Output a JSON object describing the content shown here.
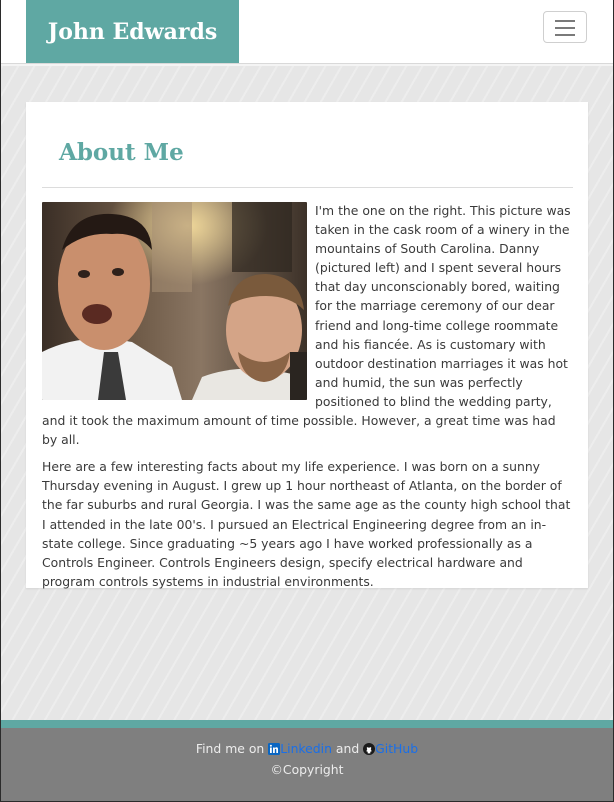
{
  "navbar": {
    "brand": "John Edwards"
  },
  "about": {
    "title": "About Me",
    "photo_alt": "Two men taking a selfie in a winery cask room",
    "paragraph1": "I'm the one on the right. This picture was taken in the cask room of a winery in the mountains of South Carolina. Danny (pictured left) and I spent several hours that day unconscionably bored, waiting for the marriage ceremony of our dear friend and long-time college roommate and his fiancée. As is customary with outdoor destination marriages it was hot and humid, the sun was perfectly positioned to blind the wedding party, and it took the maximum amount of time possible. However, a great time was had by all.",
    "paragraph2": "Here are a few interesting facts about my life experience. I was born on a sunny Thursday evening in August. I grew up 1 hour northeast of Atlanta, on the border of the far suburbs and rural Georgia. I was the same age as the county high school that I attended in the late 00's. I pursued an Electrical Engineering degree from an in-state college. Since graduating ~5 years ago I have worked professionally as a Controls Engineer. Controls Engineers design, specify electrical hardware and program controls systems in industrial environments."
  },
  "footer": {
    "find_me": "Find me on",
    "linkedin_label": "Linkedin",
    "and": "and",
    "github_label": "GitHub",
    "copyright": "©Copyright",
    "accent_color": "#5fa8a3",
    "link_color": "#1a6fe8",
    "icons": [
      "linkedin-icon",
      "github-icon"
    ]
  },
  "colors": {
    "brand": "#5fa8a3",
    "footer_bg": "#7f7f7f",
    "page_bg": "#e6e6e6"
  }
}
